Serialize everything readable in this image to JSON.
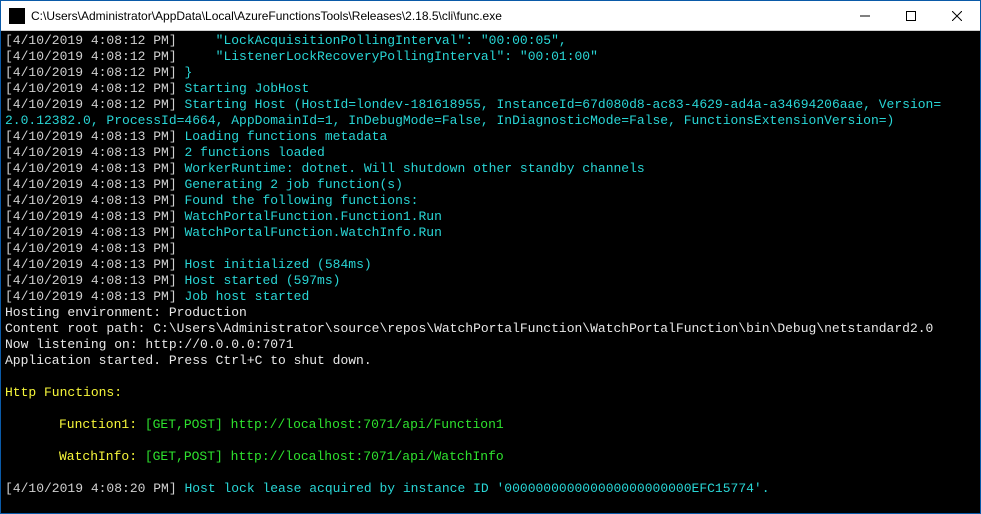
{
  "window": {
    "title": "C:\\Users\\Administrator\\AppData\\Local\\AzureFunctionsTools\\Releases\\2.18.5\\cli\\func.exe"
  },
  "logs": [
    {
      "ts": "[4/10/2019 4:08:12 PM] ",
      "segs": [
        {
          "c": "cyan",
          "t": "    \"LockAcquisitionPollingInterval\": \"00:00:05\","
        }
      ]
    },
    {
      "ts": "[4/10/2019 4:08:12 PM] ",
      "segs": [
        {
          "c": "cyan",
          "t": "    \"ListenerLockRecoveryPollingInterval\": \"00:01:00\""
        }
      ]
    },
    {
      "ts": "[4/10/2019 4:08:12 PM] ",
      "segs": [
        {
          "c": "cyan",
          "t": "}"
        }
      ]
    },
    {
      "ts": "[4/10/2019 4:08:12 PM] ",
      "segs": [
        {
          "c": "cyan",
          "t": "Starting JobHost"
        }
      ]
    },
    {
      "ts": "[4/10/2019 4:08:12 PM] ",
      "segs": [
        {
          "c": "cyan",
          "t": "Starting Host (HostId=londev-181618955, InstanceId=67d080d8-ac83-4629-ad4a-a34694206aae, Version="
        }
      ]
    },
    {
      "ts": "",
      "segs": [
        {
          "c": "cyan",
          "t": "2.0.12382.0, ProcessId=4664, AppDomainId=1, InDebugMode=False, InDiagnosticMode=False, FunctionsExtensionVersion=)"
        }
      ]
    },
    {
      "ts": "[4/10/2019 4:08:13 PM] ",
      "segs": [
        {
          "c": "cyan",
          "t": "Loading functions metadata"
        }
      ]
    },
    {
      "ts": "[4/10/2019 4:08:13 PM] ",
      "segs": [
        {
          "c": "cyan",
          "t": "2 functions loaded"
        }
      ]
    },
    {
      "ts": "[4/10/2019 4:08:13 PM] ",
      "segs": [
        {
          "c": "cyan",
          "t": "WorkerRuntime: dotnet. Will shutdown other standby channels"
        }
      ]
    },
    {
      "ts": "[4/10/2019 4:08:13 PM] ",
      "segs": [
        {
          "c": "cyan",
          "t": "Generating 2 job function(s)"
        }
      ]
    },
    {
      "ts": "[4/10/2019 4:08:13 PM] ",
      "segs": [
        {
          "c": "cyan",
          "t": "Found the following functions:"
        }
      ]
    },
    {
      "ts": "[4/10/2019 4:08:13 PM] ",
      "segs": [
        {
          "c": "cyan",
          "t": "WatchPortalFunction.Function1.Run"
        }
      ]
    },
    {
      "ts": "[4/10/2019 4:08:13 PM] ",
      "segs": [
        {
          "c": "cyan",
          "t": "WatchPortalFunction.WatchInfo.Run"
        }
      ]
    },
    {
      "ts": "[4/10/2019 4:08:13 PM] ",
      "segs": []
    },
    {
      "ts": "[4/10/2019 4:08:13 PM] ",
      "segs": [
        {
          "c": "cyan",
          "t": "Host initialized (584ms)"
        }
      ]
    },
    {
      "ts": "[4/10/2019 4:08:13 PM] ",
      "segs": [
        {
          "c": "cyan",
          "t": "Host started (597ms)"
        }
      ]
    },
    {
      "ts": "[4/10/2019 4:08:13 PM] ",
      "segs": [
        {
          "c": "cyan",
          "t": "Job host started"
        }
      ]
    },
    {
      "ts": "",
      "segs": [
        {
          "c": "white",
          "t": "Hosting environment: Production"
        }
      ]
    },
    {
      "ts": "",
      "segs": [
        {
          "c": "white",
          "t": "Content root path: C:\\Users\\Administrator\\source\\repos\\WatchPortalFunction\\WatchPortalFunction\\bin\\Debug\\netstandard2.0"
        }
      ]
    },
    {
      "ts": "",
      "segs": [
        {
          "c": "white",
          "t": "Now listening on: http://0.0.0.0:7071"
        }
      ]
    },
    {
      "ts": "",
      "segs": [
        {
          "c": "white",
          "t": "Application started. Press Ctrl+C to shut down."
        }
      ]
    }
  ],
  "http_header": "Http Functions:",
  "functions": [
    {
      "name": "Function1:",
      "methods": "[GET,POST] ",
      "url": "http://localhost:7071/api/Function1"
    },
    {
      "name": "WatchInfo:",
      "methods": "[GET,POST] ",
      "url": "http://localhost:7071/api/WatchInfo"
    }
  ],
  "tail": {
    "ts": "[4/10/2019 4:08:20 PM] ",
    "msg": "Host lock lease acquired by instance ID '000000000000000000000000EFC15774'."
  }
}
